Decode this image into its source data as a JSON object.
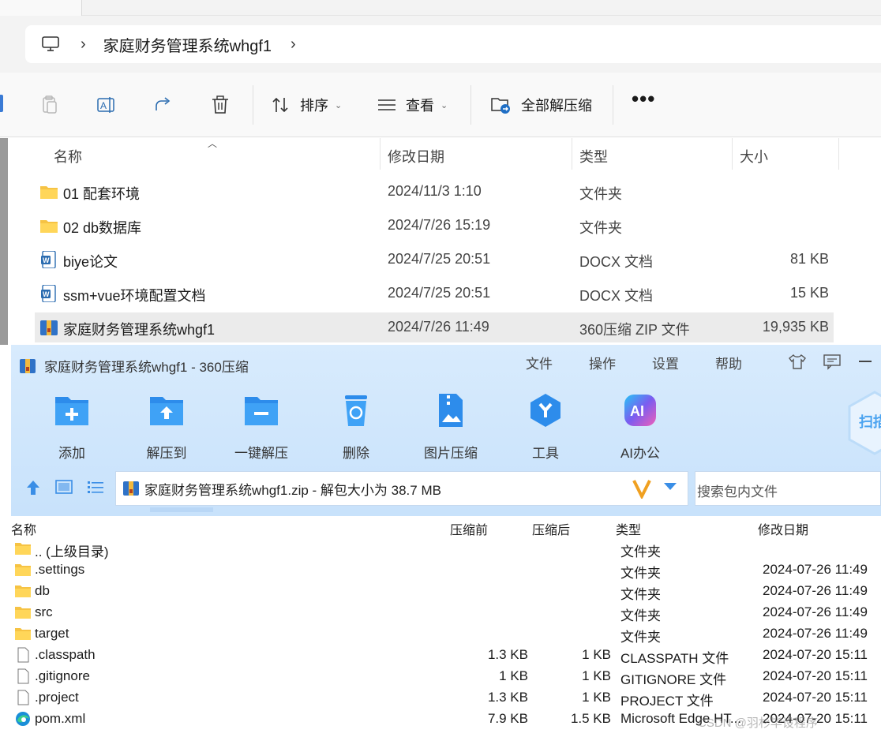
{
  "explorer": {
    "breadcrumb": [
      "家庭财务管理系统whgf1"
    ],
    "toolbar": {
      "sort_label": "排序",
      "view_label": "查看",
      "extract_all_label": "全部解压缩",
      "more_label": "•••"
    },
    "columns": {
      "name": "名称",
      "date": "修改日期",
      "type": "类型",
      "size": "大小"
    },
    "rows": [
      {
        "name": "01 配套环境",
        "date": "2024/11/3 1:10",
        "type": "文件夹",
        "size": "",
        "icon": "folder-icon"
      },
      {
        "name": "02 db数据库",
        "date": "2024/7/26 15:19",
        "type": "文件夹",
        "size": "",
        "icon": "folder-icon"
      },
      {
        "name": "biye论文",
        "date": "2024/7/25 20:51",
        "type": "DOCX 文档",
        "size": "81 KB",
        "icon": "word-doc-icon"
      },
      {
        "name": "ssm+vue环境配置文档",
        "date": "2024/7/25 20:51",
        "type": "DOCX 文档",
        "size": "15 KB",
        "icon": "word-doc-icon"
      },
      {
        "name": "家庭财务管理系统whgf1",
        "date": "2024/7/26 11:49",
        "type": "360压缩 ZIP 文件",
        "size": "19,935 KB",
        "icon": "zip-icon",
        "selected": true
      }
    ]
  },
  "zip": {
    "title": "家庭财务管理系统whgf1 - 360压缩",
    "menu": [
      "文件",
      "操作",
      "设置",
      "帮助"
    ],
    "tools": [
      {
        "label": "添加",
        "icon": "add-folder-icon"
      },
      {
        "label": "解压到",
        "icon": "extract-to-icon"
      },
      {
        "label": "一键解压",
        "icon": "one-click-extract-icon"
      },
      {
        "label": "删除",
        "icon": "delete-bin-icon"
      },
      {
        "label": "图片压缩",
        "icon": "image-compress-icon"
      },
      {
        "label": "工具",
        "icon": "tools-icon"
      },
      {
        "label": "AI办公",
        "icon": "ai-office-icon"
      }
    ],
    "scan_label": "扫描",
    "path_text": "家庭财务管理系统whgf1.zip - 解包大小为 38.7 MB",
    "search_placeholder": "搜索包内文件",
    "columns": {
      "name": "名称",
      "before": "压缩前",
      "after": "压缩后",
      "type": "类型",
      "date": "修改日期"
    },
    "rows": [
      {
        "name": ".. (上级目录)",
        "before": "",
        "after": "",
        "type": "文件夹",
        "date": "",
        "icon": "folder-icon"
      },
      {
        "name": ".settings",
        "before": "",
        "after": "",
        "type": "文件夹",
        "date": "2024-07-26 11:49",
        "icon": "folder-icon"
      },
      {
        "name": "db",
        "before": "",
        "after": "",
        "type": "文件夹",
        "date": "2024-07-26 11:49",
        "icon": "folder-icon"
      },
      {
        "name": "src",
        "before": "",
        "after": "",
        "type": "文件夹",
        "date": "2024-07-26 11:49",
        "icon": "folder-icon"
      },
      {
        "name": "target",
        "before": "",
        "after": "",
        "type": "文件夹",
        "date": "2024-07-26 11:49",
        "icon": "folder-icon"
      },
      {
        "name": ".classpath",
        "before": "1.3 KB",
        "after": "1 KB",
        "type": "CLASSPATH 文件",
        "date": "2024-07-20 15:11",
        "icon": "file-icon"
      },
      {
        "name": ".gitignore",
        "before": "1 KB",
        "after": "1 KB",
        "type": "GITIGNORE 文件",
        "date": "2024-07-20 15:11",
        "icon": "file-icon"
      },
      {
        "name": ".project",
        "before": "1.3 KB",
        "after": "1 KB",
        "type": "PROJECT 文件",
        "date": "2024-07-20 15:11",
        "icon": "file-icon"
      },
      {
        "name": "pom.xml",
        "before": "7.9 KB",
        "after": "1.5 KB",
        "type": "Microsoft Edge HT...",
        "date": "2024-07-20 15:11",
        "icon": "edge-icon"
      }
    ]
  },
  "watermark": "CSDN @羽杉毕设程序"
}
